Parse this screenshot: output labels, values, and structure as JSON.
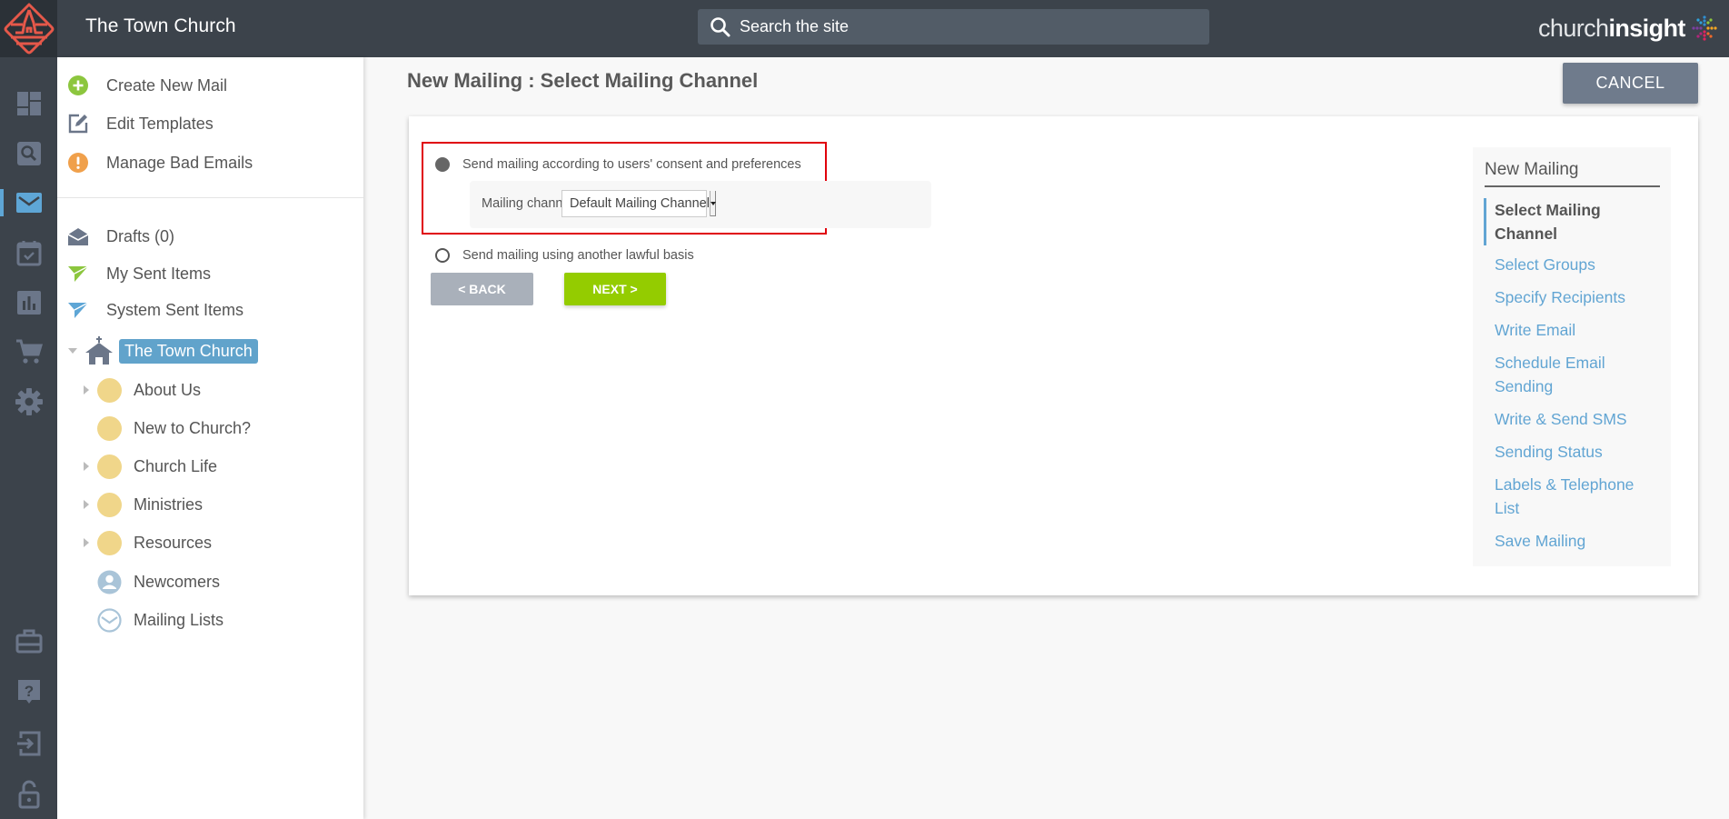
{
  "topbar": {
    "site_title": "The Town Church",
    "search_placeholder": "Search the site",
    "brand_light": "church",
    "brand_bold": "insight"
  },
  "rail": {
    "items": [
      {
        "icon": "dashboard-icon",
        "active": false
      },
      {
        "icon": "search-icon",
        "active": false
      },
      {
        "icon": "mail-icon",
        "active": true
      },
      {
        "icon": "calendar-check-icon",
        "active": false
      },
      {
        "icon": "bar-chart-icon",
        "active": false
      },
      {
        "icon": "shopping-cart-icon",
        "active": false
      },
      {
        "icon": "gear-icon",
        "active": false
      }
    ],
    "bottom_items": [
      {
        "icon": "briefcase-icon"
      },
      {
        "icon": "help-icon"
      },
      {
        "icon": "login-icon"
      },
      {
        "icon": "unlock-icon"
      }
    ],
    "accent": "#5ea6d6"
  },
  "sidebar": {
    "actions": [
      {
        "label": "Create New Mail",
        "icon": "plus-circle-icon"
      },
      {
        "label": "Edit Templates",
        "icon": "edit-icon"
      },
      {
        "label": "Manage Bad Emails",
        "icon": "warning-icon"
      }
    ],
    "folders": [
      {
        "label": "Drafts (0)",
        "icon": "open-envelope-icon"
      },
      {
        "label": "My Sent Items",
        "icon": "send-green-icon"
      },
      {
        "label": "System Sent Items",
        "icon": "send-blue-icon"
      }
    ],
    "tree": {
      "root": "The Town Church",
      "children": [
        {
          "label": "About Us",
          "expandable": true
        },
        {
          "label": "New to Church?",
          "expandable": false
        },
        {
          "label": "Church Life",
          "expandable": true
        },
        {
          "label": "Ministries",
          "expandable": true
        },
        {
          "label": "Resources",
          "expandable": true
        },
        {
          "label": "Newcomers",
          "expandable": false
        },
        {
          "label": "Mailing Lists",
          "expandable": false
        }
      ]
    }
  },
  "main": {
    "page_title": "New Mailing : Select Mailing Channel",
    "cancel_label": "CANCEL",
    "options": {
      "consent_label": "Send mailing according to users' consent and preferences",
      "consent_selected": true,
      "lawful_label": "Send mailing using another lawful basis",
      "lawful_selected": false
    },
    "channel": {
      "label": "Mailing channel:",
      "value": "Default Mailing Channel"
    },
    "back_label": "< BACK",
    "next_label": "NEXT >"
  },
  "steps": {
    "title": "New Mailing",
    "items": [
      {
        "label": "Select Mailing Channel",
        "current": true
      },
      {
        "label": "Select Groups",
        "current": false
      },
      {
        "label": "Specify Recipients",
        "current": false
      },
      {
        "label": "Write Email",
        "current": false
      },
      {
        "label": "Schedule Email Sending",
        "current": false
      },
      {
        "label": "Write & Send SMS",
        "current": false
      },
      {
        "label": "Sending Status",
        "current": false
      },
      {
        "label": "Labels & Telephone List",
        "current": false
      },
      {
        "label": "Save Mailing",
        "current": false
      }
    ]
  },
  "colors": {
    "topbar": "#3c434b",
    "brand_red": "#e5584a",
    "link_blue": "#62a5d3",
    "next_green": "#94cc00",
    "cancel_gray": "#6f7b8c",
    "highlight_red": "#e0000b"
  }
}
